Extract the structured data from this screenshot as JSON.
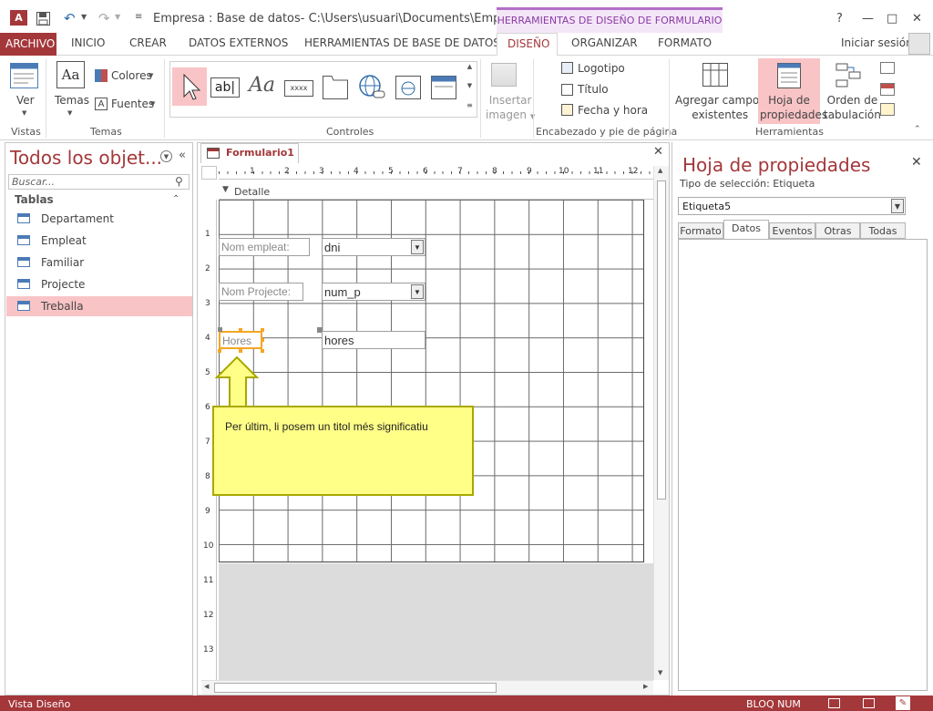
{
  "titlebar": {
    "app_title": "Empresa : Base de datos- C:\\Users\\usuari\\Documents\\Empresa.acc...",
    "context_tab": "HERRAMIENTAS DE DISEÑO DE FORMULARIO",
    "help": "?",
    "minimize": "—",
    "maximize": "□",
    "close": "✕"
  },
  "tabs": {
    "archivo": "ARCHIVO",
    "inicio": "INICIO",
    "crear": "CREAR",
    "datos_externos": "DATOS EXTERNOS",
    "herramientas_bd": "HERRAMIENTAS DE BASE DE DATOS",
    "diseno": "DISEÑO",
    "organizar": "ORGANIZAR",
    "formato": "FORMATO",
    "signin": "Iniciar sesión"
  },
  "ribbon": {
    "ver": "Ver",
    "temas": "Temas",
    "colores": "Colores",
    "fuentes": "Fuentes",
    "insertar_imagen_1": "Insertar",
    "insertar_imagen_2": "imagen",
    "logotipo": "Logotipo",
    "titulo": "Título",
    "fecha_hora": "Fecha y hora",
    "agregar_campos_1": "Agregar campos",
    "agregar_campos_2": "existentes",
    "hoja_prop_1": "Hoja de",
    "hoja_prop_2": "propiedades",
    "orden_tab_1": "Orden de",
    "orden_tab_2": "tabulación",
    "groups": {
      "vistas": "Vistas",
      "temas": "Temas",
      "controles": "Controles",
      "encabezado": "Encabezado y pie de página",
      "herramientas": "Herramientas"
    }
  },
  "nav": {
    "title": "Todos los objet...",
    "search_placeholder": "Buscar...",
    "section": "Tablas",
    "items": [
      {
        "label": "Departament"
      },
      {
        "label": "Empleat"
      },
      {
        "label": "Familiar"
      },
      {
        "label": "Projecte"
      },
      {
        "label": "Treballa"
      }
    ]
  },
  "doc": {
    "tab_title": "Formulario1",
    "section": "Detalle",
    "ruler_numbers": [
      "1",
      "2",
      "3",
      "4",
      "5",
      "6",
      "7",
      "8",
      "9",
      "10",
      "11",
      "12"
    ],
    "vruler_numbers": [
      "1",
      "2",
      "3",
      "4",
      "5",
      "6",
      "7",
      "8",
      "9",
      "10",
      "11",
      "12",
      "13"
    ],
    "controls": {
      "label_empleat": "Nom empleat:",
      "box_dni": "dni",
      "label_projecte": "Nom Projecte:",
      "box_nump": "num_p",
      "label_hores": "Hores",
      "box_hores": "hores"
    },
    "callout": "Per últim, li posem un titol més significatiu"
  },
  "props": {
    "title": "Hoja de propiedades",
    "selection_type": "Tipo de selección:  Etiqueta",
    "selected": "Etiqueta5",
    "tabs": [
      "Formato",
      "Datos",
      "Eventos",
      "Otras",
      "Todas"
    ]
  },
  "status": {
    "view": "Vista Diseño",
    "numlock": "BLOQ NUM"
  },
  "colors": {
    "accent": "#a4373a",
    "context": "#b46fc8",
    "callout": "#ffff88"
  }
}
